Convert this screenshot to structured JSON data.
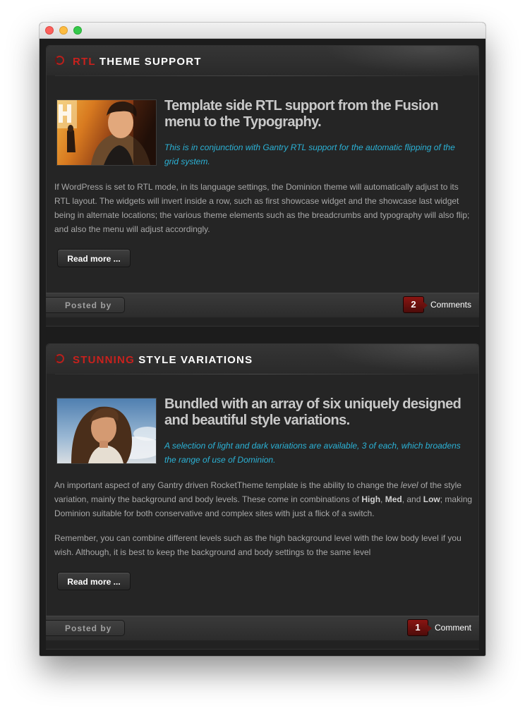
{
  "window": {
    "controls": [
      "close",
      "minimize",
      "zoom"
    ]
  },
  "posts": [
    {
      "title_accent": "RTL",
      "title_rest": " THEME SUPPORT",
      "headline": "Template side RTL support from the Fusion menu to the Typography.",
      "lead": "This is in conjunction with Gantry RTL support for the automatic flipping of the grid system.",
      "body": "If WordPress is set to RTL mode, in its language settings, the Dominion theme will automatically adjust to its RTL layout. The widgets will invert inside a row, such as first showcase widget and the showcase last widget being in alternate locations; the various theme elements such as the breadcrumbs and typography will also flip; and also the menu will adjust accordingly.",
      "read_more": "Read more ...",
      "posted_by": "Posted by",
      "comment_count": "2",
      "comment_label": "Comments"
    },
    {
      "title_accent": "STUNNING",
      "title_rest": " STYLE VARIATIONS",
      "headline": "Bundled with an array of six uniquely designed and beautiful style variations.",
      "lead": "A selection of light and dark variations are available, 3 of each, which broadens the range of use of Dominion.",
      "body1_a": "An important aspect of any Gantry driven RocketTheme template is the ability to change the ",
      "body1_em": "level",
      "body1_b": " of the style variation, mainly the background and body levels. These come in combinations of ",
      "body1_high": "High",
      "body1_sep1": ", ",
      "body1_med": "Med",
      "body1_sep2": ", and ",
      "body1_low": "Low",
      "body1_c": "; making Dominion suitable for both conservative and complex sites with just a flick of a switch.",
      "body2": "Remember, you can combine different levels such as the high background level with the low body level if you wish. Although, it is best to keep the background and body settings to the same level",
      "read_more": "Read more ...",
      "posted_by": "Posted by",
      "comment_count": "1",
      "comment_label": "Comment"
    }
  ],
  "colors": {
    "accent_red": "#c8211d",
    "lead_cyan": "#2bb2d6",
    "panel": "#252525"
  }
}
